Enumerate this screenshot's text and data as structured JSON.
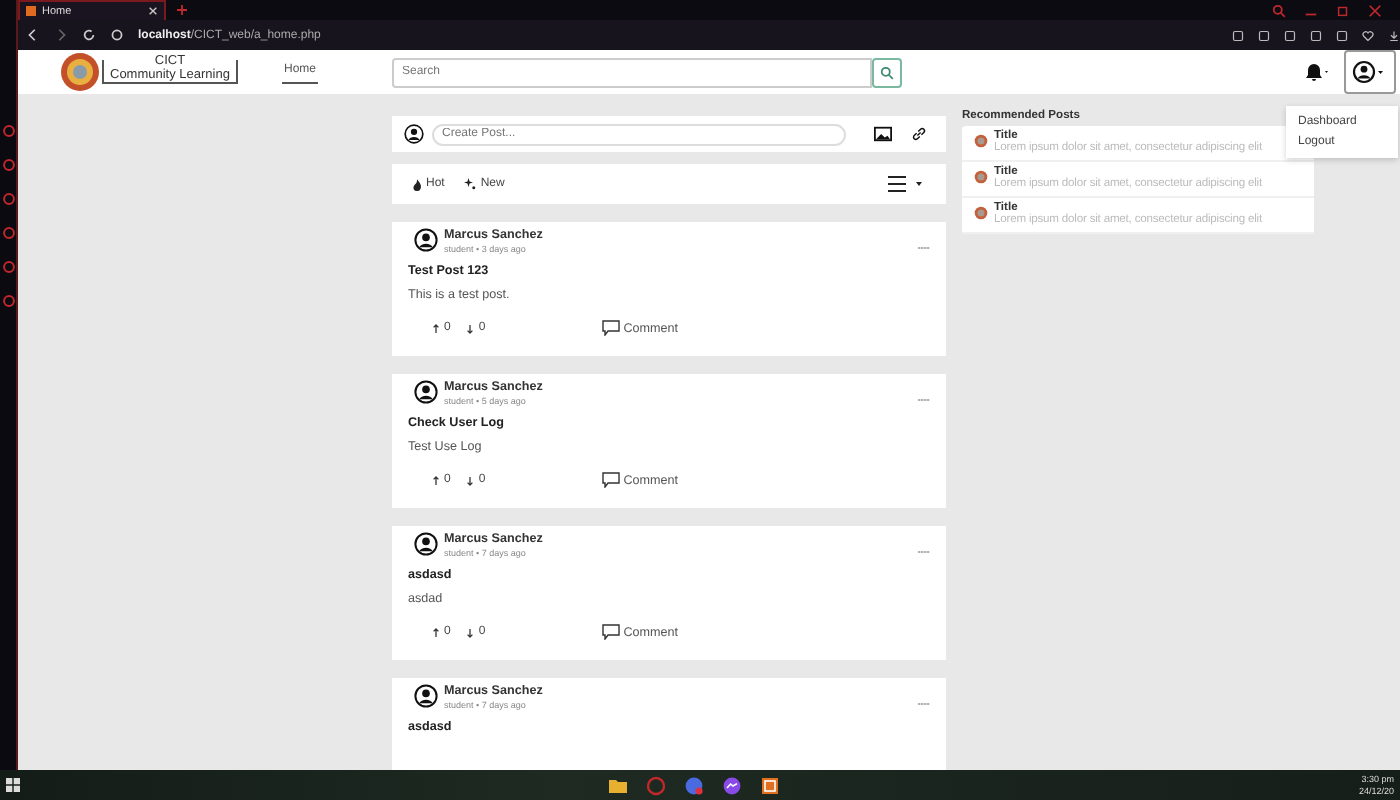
{
  "browser": {
    "tab_title": "Home",
    "url": "**localhost**/CICT_web/a_home.php"
  },
  "navbar": {
    "brand_top": "CICT",
    "brand_bottom": "Community Learning",
    "links": [
      {
        "label": "Home",
        "selected": true
      }
    ],
    "search": {
      "placeholder": "Search"
    },
    "account_menu": {
      "expanded": true,
      "items": [
        "Dashboard",
        "Logout"
      ]
    }
  },
  "composer": {
    "placeholder": "Create Post..."
  },
  "sort_tabs": [
    "Hot",
    "New"
  ],
  "posts": [
    {
      "author": "Marcus Sanchez",
      "meta": "student • 3 days ago",
      "title": "Test Post 123",
      "body": "This is a test post.",
      "upvotes": "0",
      "downvotes": "0",
      "comment": "Comment"
    },
    {
      "author": "Marcus Sanchez",
      "meta": "student • 5 days ago",
      "title": "Check User Log",
      "body": "Test Use Log",
      "upvotes": "0",
      "downvotes": "0",
      "comment": "Comment"
    },
    {
      "author": "Marcus Sanchez",
      "meta": "student • 7 days ago",
      "title": "asdasd",
      "body": "asdad",
      "upvotes": "0",
      "downvotes": "0",
      "comment": "Comment"
    },
    {
      "author": "Marcus Sanchez",
      "meta": "student • 7 days ago",
      "title": "asdasd"
    }
  ],
  "recommended": {
    "heading": "Recommended Posts",
    "items": [
      {
        "title": "Title",
        "excerpt": "Lorem ipsum dolor sit amet, consectetur adipiscing elit"
      },
      {
        "title": "Title",
        "excerpt": "Lorem ipsum dolor sit amet, consectetur adipiscing elit"
      },
      {
        "title": "Title",
        "excerpt": "Lorem ipsum dolor sit amet, consectetur adipiscing elit"
      }
    ]
  },
  "taskbar": {
    "time": "3:30 pm",
    "date": "24/12/20"
  }
}
